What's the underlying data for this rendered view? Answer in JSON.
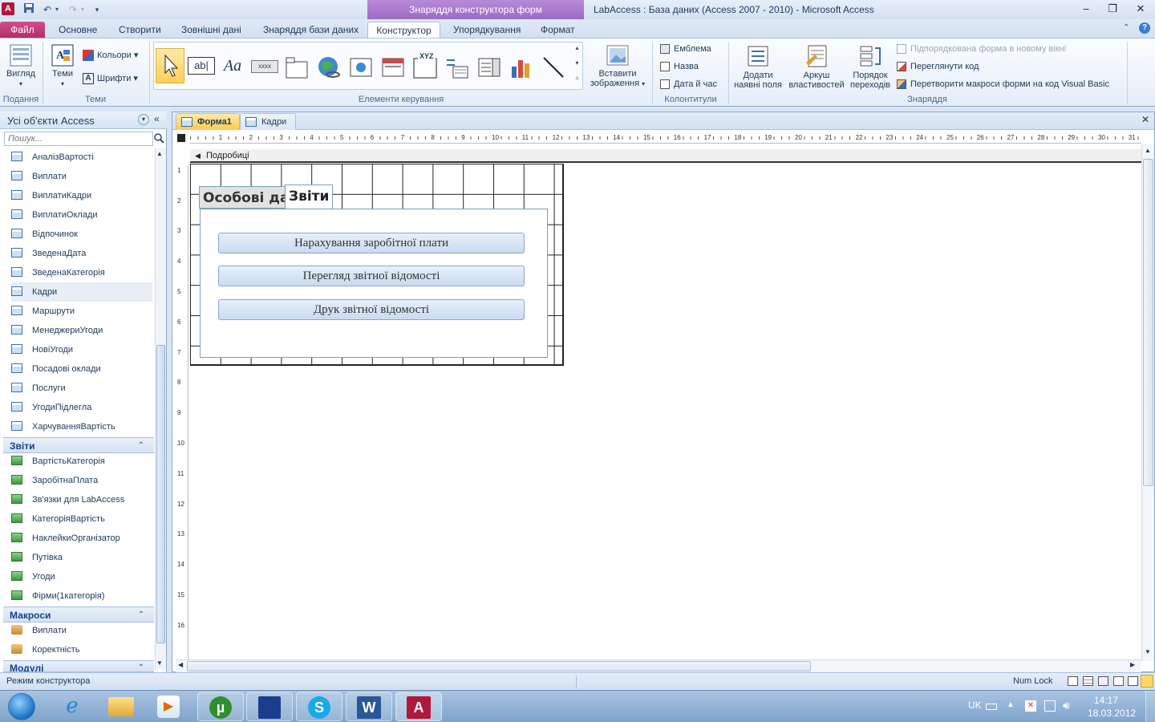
{
  "window": {
    "title": "LabAccess : База даних (Access 2007 - 2010)  -  Microsoft Access",
    "contextual_title": "Знаряддя конструктора форм",
    "minimize": "–",
    "restore": "❐",
    "close": "✕"
  },
  "tabs": {
    "file": "Файл",
    "items": [
      "Основне",
      "Створити",
      "Зовнішні дані",
      "Знаряддя бази даних",
      "Конструктор",
      "Упорядкування",
      "Формат"
    ],
    "active": "Конструктор"
  },
  "ribbon": {
    "view": {
      "label": "Вигляд",
      "group": "Подання"
    },
    "themes": {
      "label": "Теми",
      "colors": "Кольори",
      "fonts": "Шрифти",
      "group": "Теми"
    },
    "controls": {
      "group": "Елементи керування",
      "label_text": "Aa",
      "textbox_text": "ab|",
      "button_text": "xxxx",
      "title_text": "XYZ"
    },
    "insert_image": {
      "label1": "Вставити",
      "label2": "зображення",
      "chevron": "▾"
    },
    "header_footer": {
      "group": "Колонтитули",
      "logo": "Емблема",
      "title": "Назва",
      "datetime": "Дата й час"
    },
    "tools": {
      "group": "Знаряддя",
      "add_fields1": "Додати",
      "add_fields2": "наявні поля",
      "props1": "Аркуш",
      "props2": "властивостей",
      "tab_order1": "Порядок",
      "tab_order2": "переходів",
      "subform": "Підпорядкована форма в новому вікні",
      "view_code": "Переглянути код",
      "convert_macros": "Перетворити макроси форми на код Visual Basic"
    }
  },
  "nav": {
    "header": "Усі об'єкти Access",
    "search_placeholder": "Пошук...",
    "forms": [
      "АналізВартості",
      "Виплати",
      "ВиплатиКадри",
      "ВиплатиОклади",
      "Відпочинок",
      "ЗведенаДата",
      "ЗведенаКатегорія",
      "Кадри",
      "Маршрути",
      "МенеджериУгоди",
      "НовіУгоди",
      "Посадові оклади",
      "Послуги",
      "УгодиПідлегла",
      "ХарчуванняВартість"
    ],
    "selected_form": "Кадри",
    "reports_header": "Звіти",
    "reports": [
      "ВартістьКатегорія",
      "ЗаробітнаПлата",
      "Зв'язки для LabAccess",
      "КатегоріяВартість",
      "НаклейкиОрганізатор",
      "Путівка",
      "Угоди",
      "Фірми(1категорія)"
    ],
    "macros_header": "Макроси",
    "macros": [
      "Виплати",
      "Коректність"
    ],
    "modules_header": "Модулі"
  },
  "document": {
    "tabs": [
      "Форма1",
      "Кадри"
    ],
    "active_tab": "Форма1",
    "section": "Подробиці",
    "ruler_h": [
      "1",
      "2",
      "3",
      "4",
      "5",
      "6",
      "7",
      "8",
      "9",
      "10",
      "11",
      "12",
      "13",
      "14",
      "15",
      "16",
      "17",
      "18",
      "19",
      "20",
      "21",
      "22",
      "23",
      "24",
      "25",
      "26",
      "27",
      "28",
      "29",
      "30",
      "31"
    ],
    "ruler_v": [
      "1",
      "2",
      "3",
      "4",
      "5",
      "6",
      "7",
      "8",
      "9",
      "10",
      "11",
      "12",
      "13",
      "14",
      "15",
      "16"
    ],
    "tab_control": {
      "tab1": "Особові дані",
      "tab2": "Звіти",
      "buttons": [
        "Нарахування заробітної плати",
        "Перегляд звітної відомості",
        "Друк звітної відомості"
      ]
    }
  },
  "status": {
    "mode": "Режим конструктора",
    "numlock": "Num Lock"
  },
  "taskbar": {
    "lang": "UK",
    "time": "14:17",
    "date": "18.03.2012"
  },
  "colors": {
    "file_tab": "#c03a7a",
    "contextual": "#a878cc",
    "active_doc_tab": "#ffc94d"
  }
}
